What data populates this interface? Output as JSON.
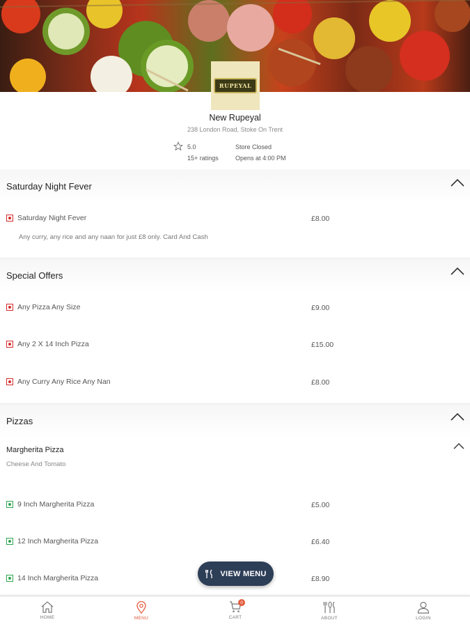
{
  "store": {
    "logo_text": "RUPEYAL",
    "name": "New Rupeyal",
    "address": "238 London Road, Stoke On Trent",
    "rating": "5.0",
    "ratings_count": "15+ ratings",
    "status": "Store Closed",
    "opens": "Opens at 4:00 PM"
  },
  "sections": [
    {
      "title": "Saturday Night Fever",
      "items": [
        {
          "name": "Saturday Night Fever",
          "price": "£8.00",
          "desc": "Any curry, any rice and any naan for just £8 only. Card And Cash",
          "type": "nonveg"
        }
      ]
    },
    {
      "title": "Special Offers",
      "items": [
        {
          "name": "Any Pizza Any Size",
          "price": "£9.00",
          "type": "nonveg"
        },
        {
          "name": "Any 2 X 14 Inch Pizza",
          "price": "£15.00",
          "type": "nonveg"
        },
        {
          "name": "Any Curry Any Rice Any Nan",
          "price": "£8.00",
          "type": "nonveg"
        }
      ]
    },
    {
      "title": "Pizzas",
      "subsection": {
        "title": "Margherita Pizza",
        "desc": "Cheese And Tomato"
      },
      "items": [
        {
          "name": "9 Inch Margherita Pizza",
          "price": "£5.00",
          "type": "veg"
        },
        {
          "name": "12 Inch Margherita Pizza",
          "price": "£6.40",
          "type": "veg"
        },
        {
          "name": "14 Inch Margherita Pizza",
          "price": "£8.90",
          "type": "veg"
        }
      ]
    }
  ],
  "view_menu": {
    "label": "VIEW MENU",
    "icon": "cutlery-icon"
  },
  "nav": [
    {
      "label": "HOME",
      "icon": "home-icon",
      "active": false
    },
    {
      "label": "MENU",
      "icon": "location-pin-icon",
      "active": true
    },
    {
      "label": "CART",
      "icon": "cart-icon",
      "badge": "0",
      "active": false
    },
    {
      "label": "ABOUT",
      "icon": "cutlery-icon",
      "active": false
    },
    {
      "label": "LOGIN",
      "icon": "user-icon",
      "active": false
    }
  ],
  "colors": {
    "accent": "#e35b3e",
    "button": "#2d3e57",
    "veg": "#2ea44f",
    "nonveg": "#d42a2a"
  }
}
